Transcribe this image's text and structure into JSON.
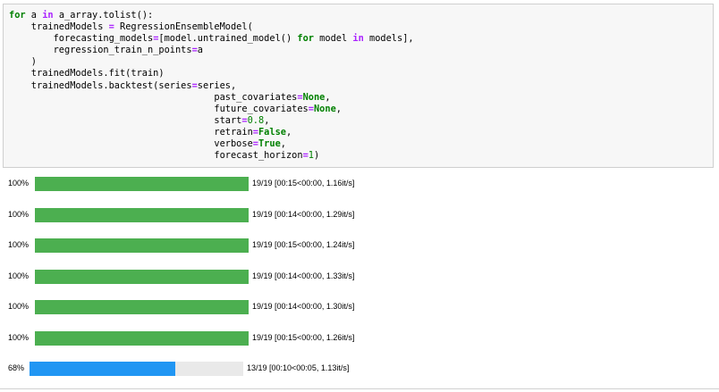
{
  "code_cell": {
    "lines": [
      [
        {
          "t": "kw",
          "s": "for"
        },
        {
          "t": "",
          "s": " a "
        },
        {
          "t": "op",
          "s": "in"
        },
        {
          "t": "",
          "s": " a_array.tolist():"
        }
      ],
      [
        {
          "t": "",
          "s": "    trainedModels "
        },
        {
          "t": "op",
          "s": "="
        },
        {
          "t": "",
          "s": " RegressionEnsembleModel("
        }
      ],
      [
        {
          "t": "",
          "s": "        forecasting_models"
        },
        {
          "t": "op",
          "s": "="
        },
        {
          "t": "",
          "s": "[model.untrained_model() "
        },
        {
          "t": "kw",
          "s": "for"
        },
        {
          "t": "",
          "s": " model "
        },
        {
          "t": "op",
          "s": "in"
        },
        {
          "t": "",
          "s": " models],"
        }
      ],
      [
        {
          "t": "",
          "s": "        regression_train_n_points"
        },
        {
          "t": "op",
          "s": "="
        },
        {
          "t": "",
          "s": "a"
        }
      ],
      [
        {
          "t": "",
          "s": "    )"
        }
      ],
      [
        {
          "t": "",
          "s": "    trainedModels.fit(train)"
        }
      ],
      [
        {
          "t": "",
          "s": "    trainedModels.backtest(series"
        },
        {
          "t": "op",
          "s": "="
        },
        {
          "t": "",
          "s": "series,"
        }
      ],
      [
        {
          "t": "",
          "s": "                                     past_covariates"
        },
        {
          "t": "op",
          "s": "="
        },
        {
          "t": "kw",
          "s": "None"
        },
        {
          "t": "",
          "s": ","
        }
      ],
      [
        {
          "t": "",
          "s": "                                     future_covariates"
        },
        {
          "t": "op",
          "s": "="
        },
        {
          "t": "kw",
          "s": "None"
        },
        {
          "t": "",
          "s": ","
        }
      ],
      [
        {
          "t": "",
          "s": "                                     start"
        },
        {
          "t": "op",
          "s": "="
        },
        {
          "t": "num",
          "s": "0.8"
        },
        {
          "t": "",
          "s": ","
        }
      ],
      [
        {
          "t": "",
          "s": "                                     retrain"
        },
        {
          "t": "op",
          "s": "="
        },
        {
          "t": "kw",
          "s": "False"
        },
        {
          "t": "",
          "s": ","
        }
      ],
      [
        {
          "t": "",
          "s": "                                     verbose"
        },
        {
          "t": "op",
          "s": "="
        },
        {
          "t": "kw",
          "s": "True"
        },
        {
          "t": "",
          "s": ","
        }
      ],
      [
        {
          "t": "",
          "s": "                                     forecast_horizon"
        },
        {
          "t": "op",
          "s": "="
        },
        {
          "t": "num",
          "s": "1"
        },
        {
          "t": "",
          "s": ")"
        }
      ]
    ]
  },
  "progress_bars": [
    {
      "percent_label": "100%",
      "progress": 1.0,
      "info": "19/19 [00:15<00:00,  1.16it/s]",
      "color": "#4caf50"
    },
    {
      "percent_label": "100%",
      "progress": 1.0,
      "info": "19/19 [00:14<00:00,  1.29it/s]",
      "color": "#4caf50"
    },
    {
      "percent_label": "100%",
      "progress": 1.0,
      "info": "19/19 [00:15<00:00,  1.24it/s]",
      "color": "#4caf50"
    },
    {
      "percent_label": "100%",
      "progress": 1.0,
      "info": "19/19 [00:14<00:00,  1.33it/s]",
      "color": "#4caf50"
    },
    {
      "percent_label": "100%",
      "progress": 1.0,
      "info": "19/19 [00:14<00:00,  1.30it/s]",
      "color": "#4caf50"
    },
    {
      "percent_label": "100%",
      "progress": 1.0,
      "info": "19/19 [00:15<00:00,  1.26it/s]",
      "color": "#4caf50"
    },
    {
      "percent_label": "68%",
      "progress": 0.68,
      "info": "13/19 [00:10<00:05,  1.13it/s]",
      "color": "#2196f3"
    }
  ]
}
